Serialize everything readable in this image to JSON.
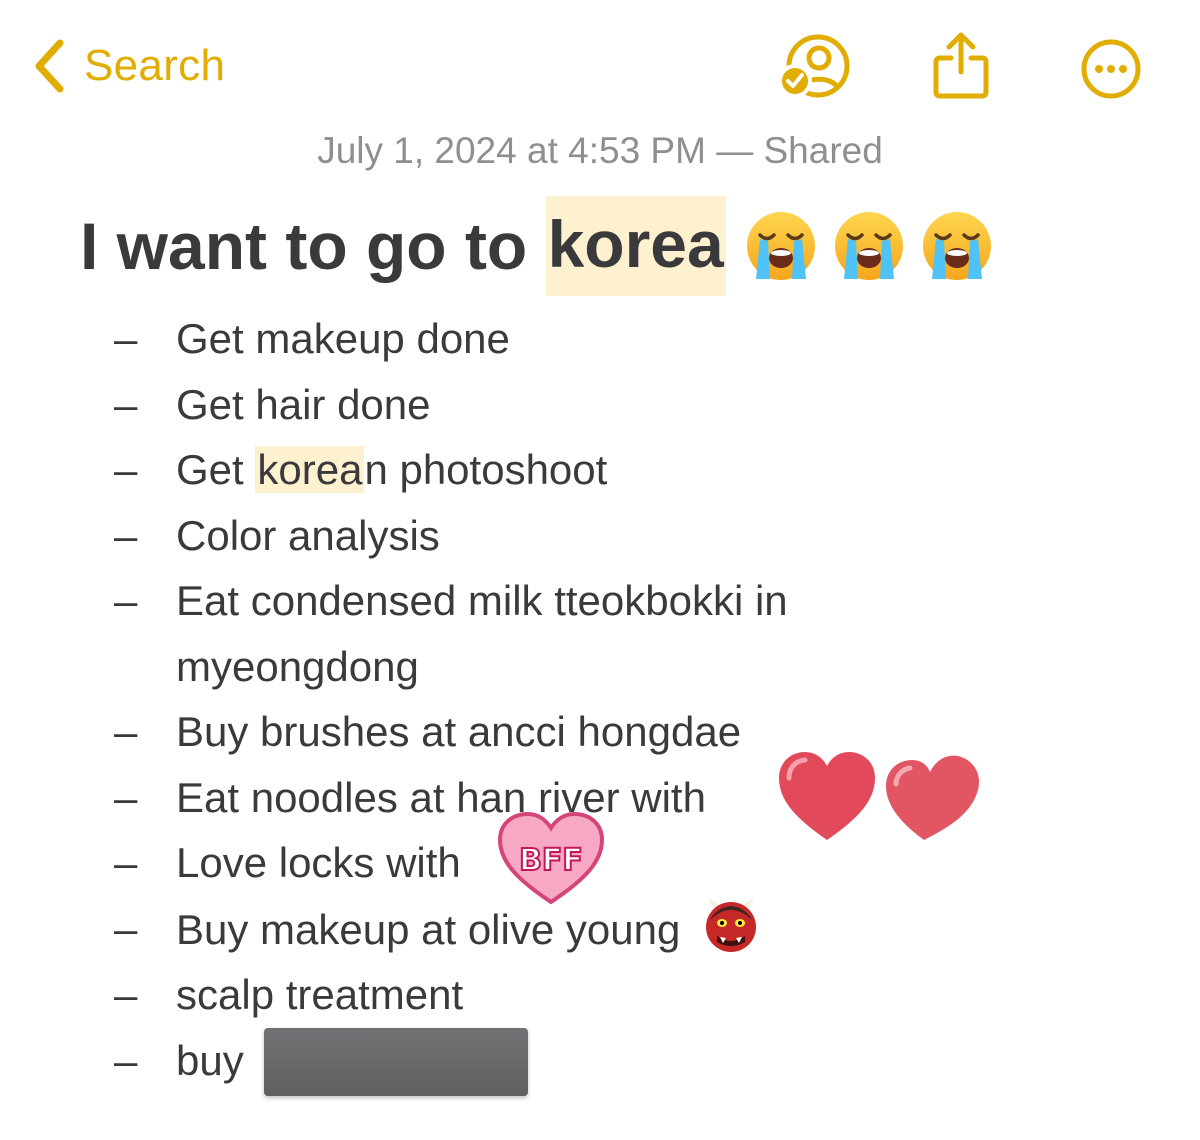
{
  "nav": {
    "back_label": "Search"
  },
  "note": {
    "meta": "July 1, 2024 at 4:53 PM — Shared",
    "title_before": "I want to go to ",
    "title_highlight": "korea",
    "items": [
      {
        "text": "Get makeup done"
      },
      {
        "text": "Get hair done"
      },
      {
        "pre": "Get ",
        "highlight": "korea",
        "post": "n photoshoot"
      },
      {
        "text": "Color analysis"
      },
      {
        "text": "Eat condensed milk tteokbokki in",
        "cont": "myeongdong"
      },
      {
        "text": "Buy brushes at ancci hongdae"
      },
      {
        "text": "Eat noodles at han river with"
      },
      {
        "text": "Love locks with"
      },
      {
        "text": "Buy makeup at olive young"
      },
      {
        "text": "scalp treatment"
      },
      {
        "text": "buy"
      }
    ]
  },
  "stickers": {
    "bff_text": "BFF"
  },
  "icons": {
    "back": "chevron-left-icon",
    "collaborate": "person-checkmark-icon",
    "share": "share-icon",
    "more": "ellipsis-circle-icon",
    "crying": "loudly-crying-face-emoji",
    "ogre": "ogre-emoji"
  },
  "colors": {
    "accent": "#e1ad01",
    "highlight": "#fdf1cf",
    "text": "#3a3a3c",
    "meta": "#8e8e93"
  }
}
